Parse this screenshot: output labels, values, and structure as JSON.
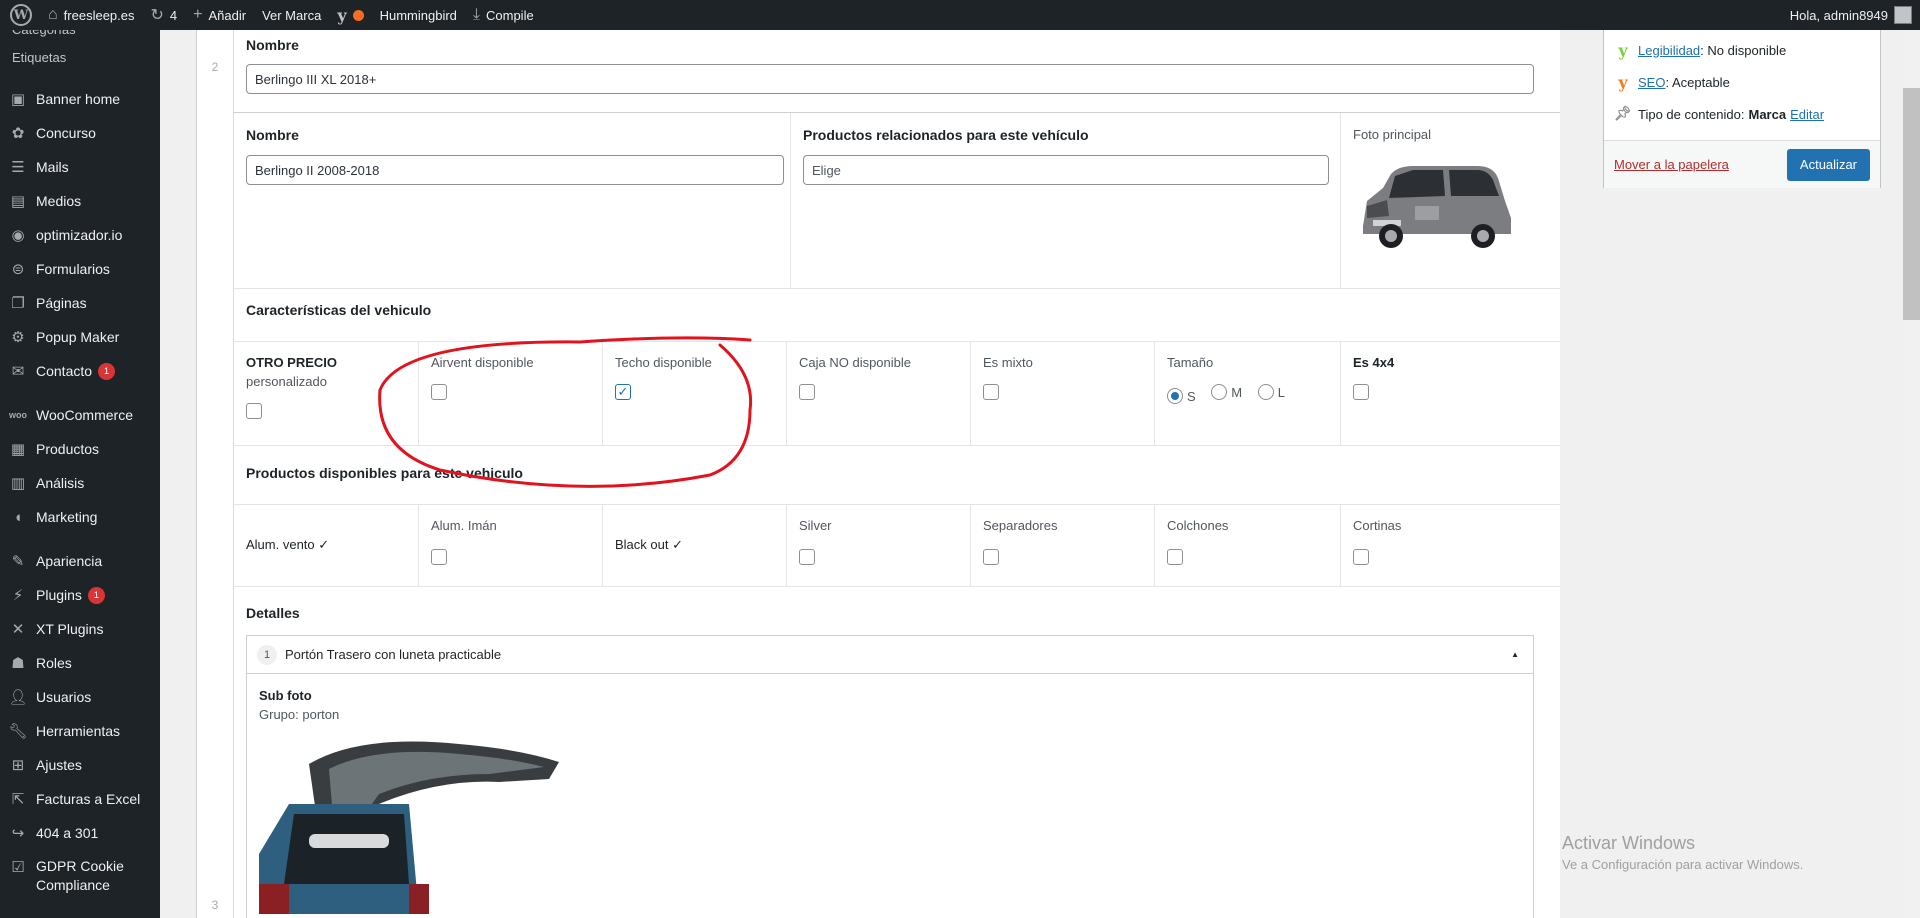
{
  "adminbar": {
    "site_name": "freesleep.es",
    "updates_count": "4",
    "add_new": "Añadir",
    "view_brand": "Ver Marca",
    "hummingbird": "Hummingbird",
    "compile": "Compile",
    "greeting": "Hola, admin8949"
  },
  "sidebar": {
    "sub_items": [
      "Categorías",
      "Etiquetas"
    ],
    "items": [
      {
        "label": "Banner home",
        "icon": "dashboard-icon"
      },
      {
        "label": "Concurso",
        "icon": "gift-icon"
      },
      {
        "label": "Mails",
        "icon": "list-icon"
      },
      {
        "label": "Medios",
        "icon": "media-icon"
      },
      {
        "label": "optimizador.io",
        "icon": "gauge-icon"
      },
      {
        "label": "Formularios",
        "icon": "forms-icon"
      },
      {
        "label": "Páginas",
        "icon": "pages-icon"
      },
      {
        "label": "Popup Maker",
        "icon": "popup-icon"
      },
      {
        "label": "Contacto",
        "icon": "mail-icon",
        "badge": "1"
      },
      {
        "label": "WooCommerce",
        "icon": "woo-icon"
      },
      {
        "label": "Productos",
        "icon": "products-icon"
      },
      {
        "label": "Análisis",
        "icon": "chart-icon"
      },
      {
        "label": "Marketing",
        "icon": "megaphone-icon"
      },
      {
        "label": "Apariencia",
        "icon": "brush-icon"
      },
      {
        "label": "Plugins",
        "icon": "plug-icon",
        "badge": "1"
      },
      {
        "label": "XT Plugins",
        "icon": "xt-icon"
      },
      {
        "label": "Roles",
        "icon": "roles-icon"
      },
      {
        "label": "Usuarios",
        "icon": "user-icon"
      },
      {
        "label": "Herramientas",
        "icon": "wrench-icon"
      },
      {
        "label": "Ajustes",
        "icon": "settings-icon"
      },
      {
        "label": "Facturas a Excel",
        "icon": "export-icon"
      },
      {
        "label": "404 a 301",
        "icon": "redirect-icon"
      },
      {
        "label": "GDPR Cookie Compliance",
        "icon": "check-icon"
      }
    ]
  },
  "row2": {
    "index": "2",
    "name_label": "Nombre",
    "name_value": "Berlingo III XL 2018+"
  },
  "vehicle": {
    "name_label": "Nombre",
    "name_value": "Berlingo II 2008-2018",
    "related_label": "Productos relacionados para este vehículo",
    "related_placeholder": "Elige",
    "photo_label": "Foto principal",
    "features_label": "Características del vehiculo",
    "otro_precio": "OTRO PRECIO",
    "personalizado": "personalizado",
    "airvent": "Airvent disponible",
    "techo": "Techo disponible",
    "caja": "Caja NO disponible",
    "mixto": "Es mixto",
    "tamano": "Tamaño",
    "size_options": [
      "S",
      "M",
      "L"
    ],
    "selected_size": "S",
    "es4x4": "Es 4x4",
    "products_label": "Productos disponibles para este vehiculo",
    "alum_vento": "Alum. vento ✓",
    "alum_iman": "Alum. Imán",
    "black_out": "Black out ✓",
    "silver": "Silver",
    "separadores": "Separadores",
    "colchones": "Colchones",
    "cortinas": "Cortinas",
    "details_label": "Detalles",
    "detail_index": "1",
    "detail_title": "Portón Trasero con luneta practicable",
    "sub_foto": "Sub foto",
    "grupo": "Grupo: porton",
    "row3_index": "3"
  },
  "checks": {
    "otro_precio": false,
    "airvent": false,
    "techo": true,
    "caja": false,
    "mixto": false,
    "es4x4": false,
    "alum_iman": false,
    "silver": false,
    "separadores": false,
    "colchones": false,
    "cortinas": false
  },
  "publish": {
    "readability_link": "Legibilidad",
    "readability_value": ": No disponible",
    "seo_link": "SEO",
    "seo_value": ": Aceptable",
    "content_type_label": "Tipo de contenido: ",
    "content_type_value": "Marca",
    "edit_link": "Editar",
    "trash": "Mover a la papelera",
    "update": "Actualizar"
  },
  "watermark": {
    "line1": "Activar Windows",
    "line2": "Ve a Configuración para activar Windows."
  },
  "colors": {
    "accent": "#2271b1",
    "admin_bar": "#1d2327",
    "badge": "#d63638",
    "annotation": "#e0141e",
    "yoast_green": "#7ad03a",
    "yoast_orange": "#ee7c1b"
  }
}
